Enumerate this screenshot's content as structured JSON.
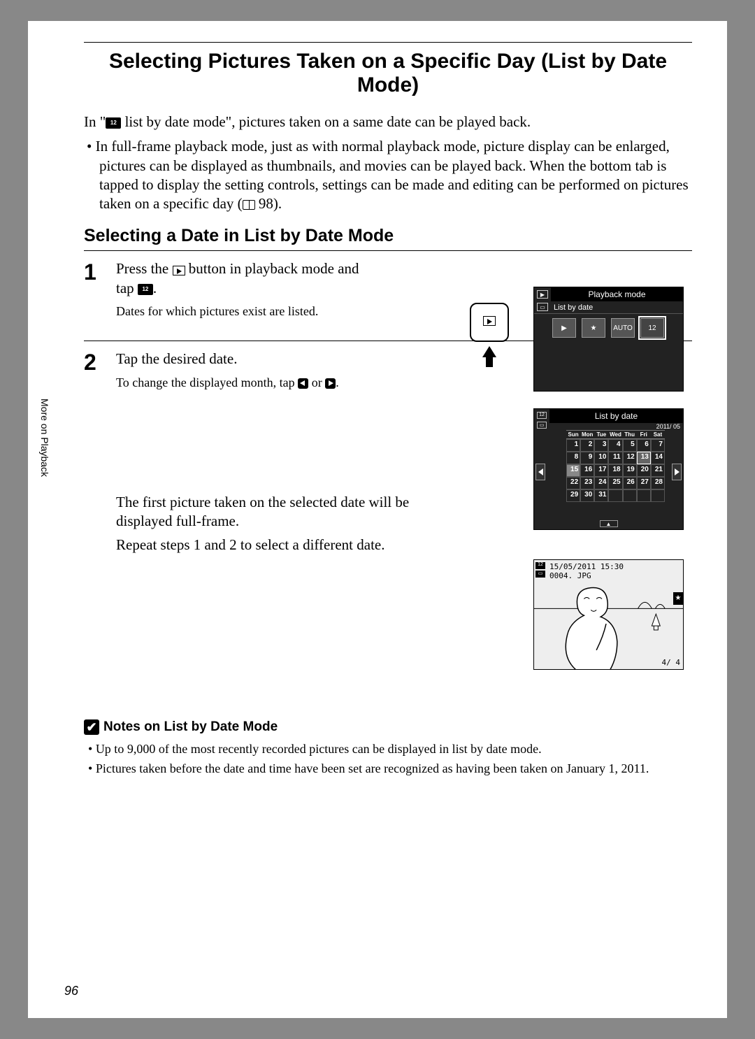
{
  "sidebar_label": "More on Playback",
  "page_number": "96",
  "title": "Selecting Pictures Taken on a Specific Day (List by Date Mode)",
  "intro_line": "In \" list by date mode\", pictures taken on a same date can be played back.",
  "intro_bullet": "In full-frame playback mode, just as with normal playback mode, picture display can be enlarged, pictures can be displayed as thumbnails, and movies can be played back. When the bottom tab is tapped to display the setting controls, settings can be made and editing can be performed on pictures taken on a specific day ( 98).",
  "subheading": "Selecting a Date in List by Date Mode",
  "steps": {
    "s1": {
      "num": "1",
      "title_a": "Press the ",
      "title_b": " button in playback mode and tap ",
      "sub": "Dates for which pictures exist are listed."
    },
    "s2": {
      "num": "2",
      "title": "Tap the desired date.",
      "sub_a": "To change the displayed month, tap ",
      "sub_b": " or ",
      "para1": "The first picture taken on the selected date will be displayed full-frame.",
      "para2": "Repeat steps 1 and 2 to select a different date."
    }
  },
  "fig_playback_menu": {
    "title": "Playback mode",
    "row_label": "List by date",
    "icons": [
      "▶",
      "★",
      "AUTO",
      "12"
    ]
  },
  "fig_calendar": {
    "title": "List by date",
    "year_month": "2011/ 05",
    "weekdays": [
      "Sun",
      "Mon",
      "Tue",
      "Wed",
      "Thu",
      "Fri",
      "Sat"
    ],
    "weeks": [
      [
        "1",
        "2",
        "3",
        "4",
        "5",
        "6",
        "7"
      ],
      [
        "8",
        "9",
        "10",
        "11",
        "12",
        "13",
        "14"
      ],
      [
        "15",
        "16",
        "17",
        "18",
        "19",
        "20",
        "21"
      ],
      [
        "22",
        "23",
        "24",
        "25",
        "26",
        "27",
        "28"
      ],
      [
        "29",
        "30",
        "31",
        "",
        "",
        "",
        ""
      ]
    ],
    "highlighted": [
      "13",
      "15"
    ]
  },
  "fig_photo": {
    "timestamp": "15/05/2011 15:30",
    "filename": "0004. JPG",
    "counter": "4/    4"
  },
  "notes": {
    "heading": "Notes on List by Date Mode",
    "b1": "Up to 9,000 of the most recently recorded pictures can be displayed in list by date mode.",
    "b2": "Pictures taken before the date and time have been set are recognized as having been taken on January 1, 2011."
  }
}
